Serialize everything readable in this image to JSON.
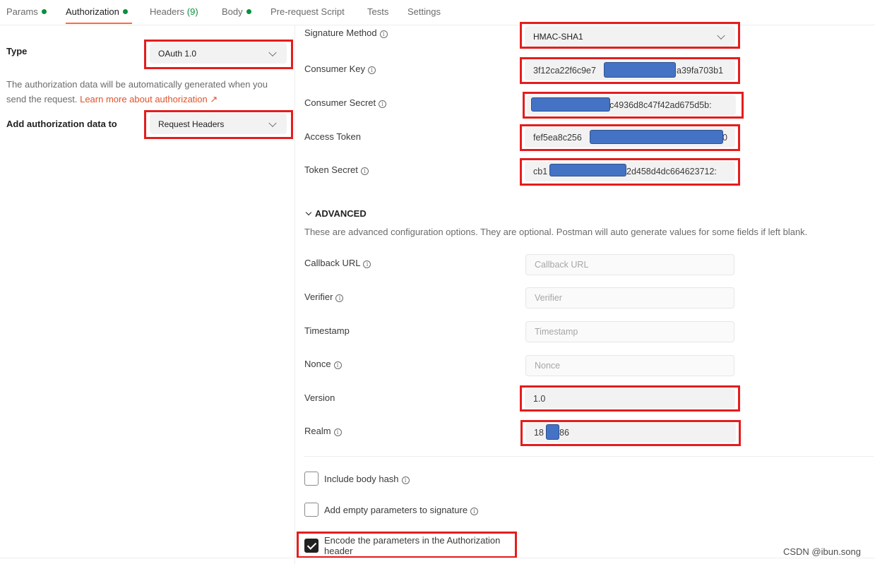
{
  "tabs": [
    {
      "label": "Params",
      "dot": true
    },
    {
      "label": "Authorization",
      "dot": true,
      "active": true
    },
    {
      "label": "Headers",
      "count": "(9)"
    },
    {
      "label": "Body",
      "dot": true
    },
    {
      "label": "Pre-request Script"
    },
    {
      "label": "Tests"
    },
    {
      "label": "Settings"
    }
  ],
  "left": {
    "type_label": "Type",
    "type_value": "OAuth 1.0",
    "description": "The authorization data will be automatically generated when you send the request.",
    "learn_more": "Learn more about authorization ↗",
    "add_to_label": "Add authorization data to",
    "add_to_value": "Request Headers"
  },
  "fields": {
    "signature_method": {
      "label": "Signature Method",
      "value": "HMAC-SHA1"
    },
    "consumer_key": {
      "label": "Consumer Key",
      "value_start": "3f12ca22f6c9e7",
      "value_end": "a39fa703b1"
    },
    "consumer_secret": {
      "label": "Consumer Secret",
      "value_end": "c4936d8c47f42ad675d5b:"
    },
    "access_token": {
      "label": "Access Token",
      "value_start": "fef5ea8c256",
      "value_end": "0"
    },
    "token_secret": {
      "label": "Token Secret",
      "value_start": "cb1",
      "value_end": "2d458d4dc664623712:"
    }
  },
  "advanced": {
    "heading": "ADVANCED",
    "description": "These are advanced configuration options. They are optional. Postman will auto generate values for some fields if left blank.",
    "callback_url": {
      "label": "Callback URL",
      "placeholder": "Callback URL"
    },
    "verifier": {
      "label": "Verifier",
      "placeholder": "Verifier"
    },
    "timestamp": {
      "label": "Timestamp",
      "placeholder": "Timestamp"
    },
    "nonce": {
      "label": "Nonce",
      "placeholder": "Nonce"
    },
    "version": {
      "label": "Version",
      "value": "1.0"
    },
    "realm": {
      "label": "Realm",
      "value_start": "18",
      "value_end": "86"
    }
  },
  "checkboxes": [
    {
      "label": "Include body hash",
      "checked": false,
      "info": true
    },
    {
      "label": "Add empty parameters to signature",
      "checked": false,
      "info": true
    },
    {
      "label": "Encode the parameters in the Authorization header",
      "checked": true
    }
  ],
  "watermark": "CSDN @ibun.song",
  "colors": {
    "accent": "#ff6c37",
    "status_dot": "#0a8f3e",
    "highlight_box": "#e41d1d",
    "redaction": "#4472c4",
    "link": "#e0522a"
  }
}
